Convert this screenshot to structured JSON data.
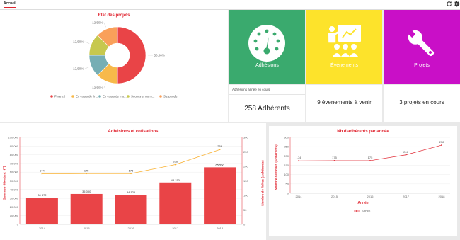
{
  "topbar": {
    "tab_label": "Accueil",
    "icons": [
      "refresh-icon",
      "gear-icon"
    ]
  },
  "colors": {
    "accent": "#e0242f",
    "green": "#3aaa6e",
    "yellow": "#fde32b",
    "magenta": "#c90fc7",
    "pie": [
      "#e94447",
      "#f7b94a",
      "#76aeb4",
      "#c7c84e",
      "#f9a05a"
    ]
  },
  "tiles": [
    {
      "label": "Adhésions",
      "icon": "gauge-icon",
      "color": "#3aaa6e"
    },
    {
      "label": "Événements",
      "icon": "presentation-icon",
      "color": "#fde32b"
    },
    {
      "label": "Projets",
      "icon": "wrench-icon",
      "color": "#c90fc7"
    }
  ],
  "stats": {
    "adhesions_caption": "Adhésions année en cours",
    "adhesions": "258 Adhérents",
    "events": "9 évenements à venir",
    "projects": "3 projets en cours"
  },
  "chart_data": [
    {
      "type": "pie",
      "title": "Etat des projets",
      "categories": [
        "Financé",
        "En cours de fin...",
        "En cours de mo...",
        "Soumis et non r...",
        "Suspendu"
      ],
      "values": [
        50.0,
        12.5,
        12.5,
        12.5,
        12.5
      ],
      "slice_labels": [
        "50,00%",
        "12,50%",
        "12,50%",
        "12,50%",
        "12,50%"
      ],
      "legend": "bottom"
    },
    {
      "type": "bar",
      "title": "Adhésions et cotisations",
      "categories": [
        "2014",
        "2015",
        "2016",
        "2017",
        "2018"
      ],
      "series": [
        {
          "values": [
            30872,
            35000,
            34125,
            48150,
            65550
          ],
          "labels": [
            "30 872",
            "35 000",
            "34 125",
            "48 150",
            "65 550"
          ]
        },
        {
          "type": "line",
          "axis": "right",
          "values": [
            174,
            175,
            175,
            206,
            258
          ],
          "labels": [
            "174",
            "175",
            "175",
            "206",
            "258"
          ]
        }
      ],
      "ylabel": "Sommes (Montant HT)",
      "y2label": "Nombre de fiches (Adhérents)",
      "ylim": [
        0,
        100000
      ],
      "y2lim": [
        0,
        300
      ],
      "yticks": [
        "0",
        "10 000",
        "20 000",
        "30 000",
        "40 000",
        "50 000",
        "60 000",
        "70 000",
        "80 000",
        "90 000",
        "100 000"
      ],
      "y2ticks": [
        "0",
        "50",
        "100",
        "150",
        "200",
        "250",
        "300"
      ],
      "grid": true
    },
    {
      "type": "line",
      "title": "Nb d'adhérents par année",
      "categories": [
        "2014",
        "2015",
        "2016",
        "2017",
        "2018"
      ],
      "series": [
        {
          "name": "Année",
          "values": [
            174,
            175,
            175,
            206,
            258
          ],
          "labels": [
            "174",
            "175",
            "175",
            "206",
            "258"
          ]
        }
      ],
      "xlabel": "Année",
      "ylabel": "Nombre de fiches (Adhérents)",
      "ylim": [
        0,
        300
      ],
      "yticks": [
        "0",
        "50",
        "100",
        "150",
        "200",
        "250",
        "300"
      ],
      "legend": "bottom",
      "grid": true
    }
  ]
}
